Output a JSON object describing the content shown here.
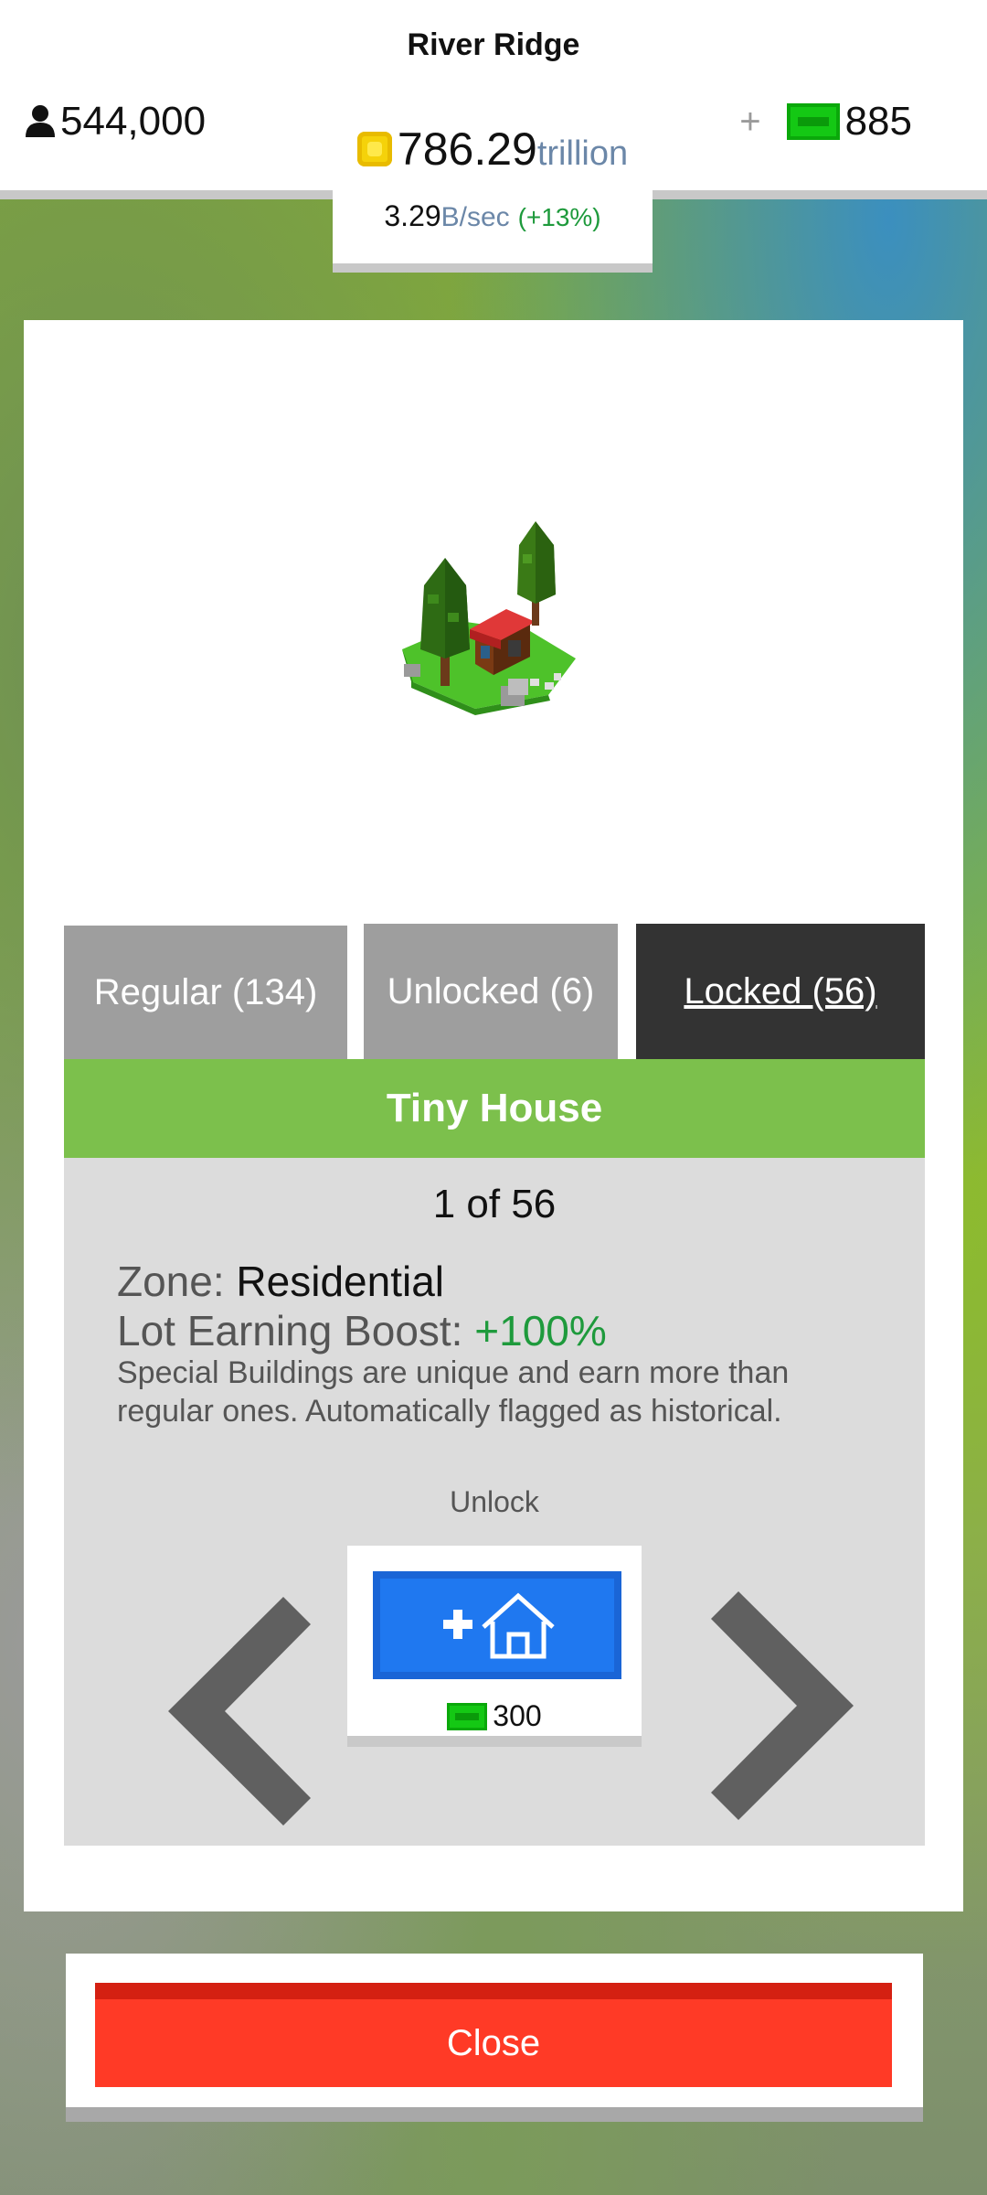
{
  "header": {
    "city_name": "River Ridge",
    "population": "544,000",
    "cash_plus": "+",
    "cash": "885",
    "coins_value": "786.29",
    "coins_unit": "trillion",
    "rate_value": "3.29",
    "rate_unit": "B/sec",
    "rate_boost": "(+13%)"
  },
  "tabs": [
    {
      "label": "Regular (134)"
    },
    {
      "label": "Unlocked (6)"
    },
    {
      "label": "Locked (56)"
    }
  ],
  "building": {
    "name": "Tiny House",
    "counter": "1 of 56",
    "zone_label": "Zone: ",
    "zone_value": "Residential",
    "boost_label": "Lot Earning Boost: ",
    "boost_value": "+100%",
    "description": "Special Buildings are unique and earn more than regular ones. Automatically flagged as historical."
  },
  "unlock": {
    "label": "Unlock",
    "price": "300"
  },
  "close_label": "Close",
  "colors": {
    "cash_green": "#14c814",
    "tab_active": "#333333",
    "title_green": "#7cc04c",
    "unlock_blue": "#1f78f0",
    "close_red": "#ff3a26"
  }
}
